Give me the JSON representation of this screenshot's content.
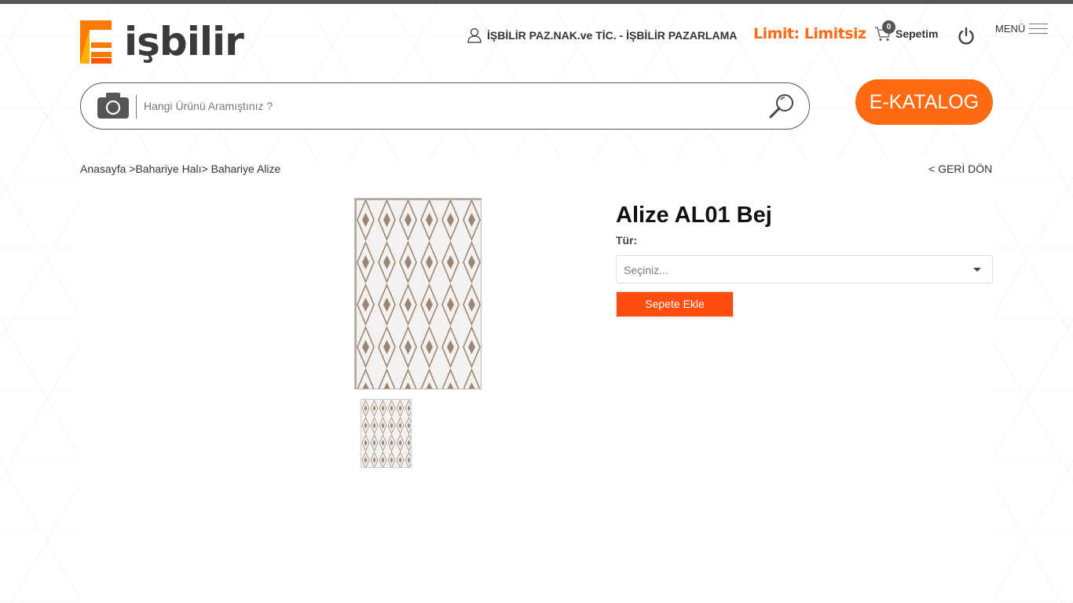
{
  "brand": {
    "logo_text": "işbilir",
    "logo_mark_letter": "E"
  },
  "header": {
    "user_name": "İŞBİLİR PAZ.NAK.ve TİC. - İŞBİLİR PAZARLAMA",
    "limit_text": "Limit: Limitsiz",
    "cart_count": "0",
    "cart_label": "Sepetim",
    "menu_label": "MENÜ"
  },
  "search": {
    "placeholder": "Hangi Ürünü Aramıştınız ?"
  },
  "ekatalog_label": "E-KATALOG",
  "breadcrumb": {
    "home": "Anasayfa",
    "sep1": " >",
    "category": "Bahariye Halı",
    "sep2": "> ",
    "subcategory": "Bahariye Alize"
  },
  "back_label": "< GERİ DÖN",
  "product": {
    "title": "Alize AL01 Bej",
    "type_label": "Tür:",
    "type_select_value": "Seçiniz...",
    "add_to_cart_label": "Sepete Ekle"
  },
  "icons": {
    "user": "user-icon",
    "cart": "cart-icon",
    "power": "power-icon",
    "menu": "hamburger-icon",
    "camera": "camera-icon",
    "search": "search-icon"
  },
  "colors": {
    "accent_orange": "#ff6a13",
    "button_orange": "#ff4e0f",
    "top_bar": "#555555",
    "rug_pattern": "#9b8574"
  }
}
